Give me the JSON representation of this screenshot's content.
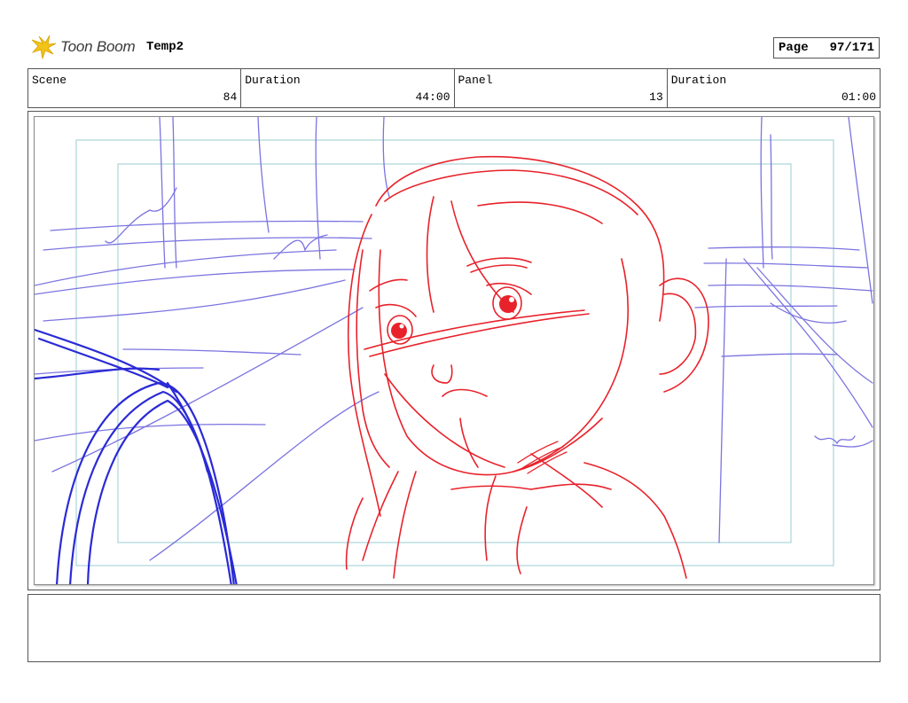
{
  "header": {
    "brand": "Toon Boom",
    "project": "Temp2",
    "page_label": "Page",
    "page_value": "97/171"
  },
  "info": {
    "scene_label": "Scene",
    "scene_value": "84",
    "duration_label": "Duration",
    "duration_value": "44:00",
    "panel_label": "Panel",
    "panel_value": "13",
    "panel_duration_label": "Duration",
    "panel_duration_value": "01:00"
  },
  "colors": {
    "sketch_red": "#e8222b",
    "sketch_blue": "#2a2ad6",
    "sketch_lilac": "#7b74e0",
    "safe_frame": "#a9d6d9",
    "logo_yellow": "#f2c318"
  },
  "notes": ""
}
